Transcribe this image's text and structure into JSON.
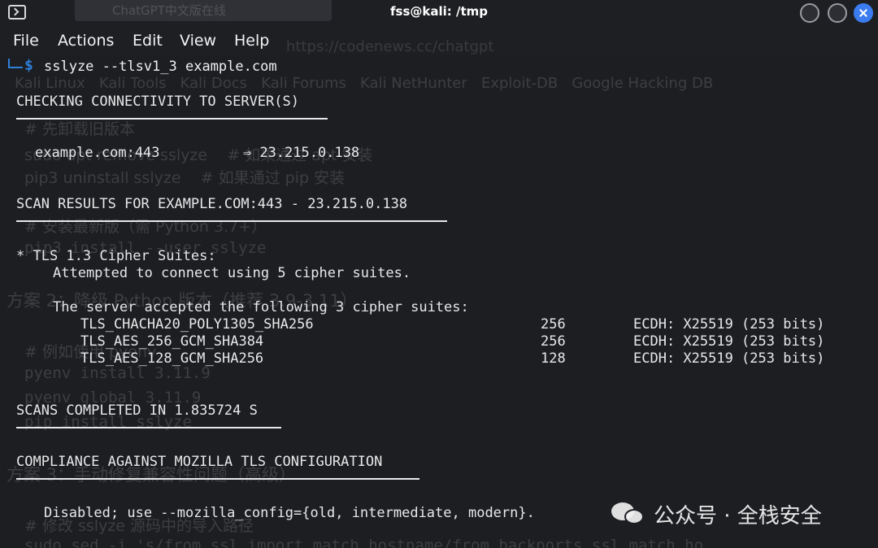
{
  "window": {
    "title": "fss@kali: /tmp",
    "ghost_tab": "ChatGPT中文版在线"
  },
  "menu": [
    "File",
    "Actions",
    "Edit",
    "View",
    "Help"
  ],
  "ghost_url": "https://codenews.cc/chatgpt",
  "prompt": {
    "symbol": "$",
    "command": "sslyze --tlsv1_3 example.com"
  },
  "terminal": {
    "header_connectivity": "CHECKING CONNECTIVITY TO SERVER(S)",
    "connectivity_line": "example.com:443          ⇒ 23.215.0.138",
    "header_scan": "SCAN RESULTS FOR EXAMPLE.COM:443 - 23.215.0.138",
    "tls_title": "* TLS 1.3 Cipher Suites:",
    "attempted": "Attempted to connect using 5 cipher suites.",
    "accepted": "The server accepted the following 3 cipher suites:",
    "ciphers": [
      {
        "name": "TLS_CHACHA20_POLY1305_SHA256",
        "bits": "256",
        "kex": "ECDH: X25519 (253 bits)"
      },
      {
        "name": "TLS_AES_256_GCM_SHA384",
        "bits": "256",
        "kex": "ECDH: X25519 (253 bits)"
      },
      {
        "name": "TLS_AES_128_GCM_SHA256",
        "bits": "128",
        "kex": "ECDH: X25519 (253 bits)"
      }
    ],
    "header_completed": "SCANS COMPLETED IN 1.835724 S",
    "header_compliance": "COMPLIANCE AGAINST MOZILLA TLS CONFIGURATION",
    "disabled_line": "Disabled; use --mozilla_config={old, intermediate, modern}."
  },
  "ghost_bookmarks": "Kali Linux   Kali Tools   Kali Docs   Kali Forums   Kali NetHunter   Exploit-DB   Google Hacking DB",
  "ghost_lines": [
    "# 先卸载旧版本",
    "sudo apt remove sslyze    # 如果通过 apt 安装",
    "pip3 uninstall sslyze    # 如果通过 pip 安装",
    "# 安装最新版（需 Python 3.7+）",
    "pip3 install --user sslyze",
    "方案 2：降级 Python 版本（推荐 3.9-3.11）",
    "# 例如使用 pyenv",
    "pyenv install 3.11.9",
    "pyenv global 3.11.9",
    "pip install sslyze",
    "方案 3：手动修复兼容性问题（高级）",
    "# 修改 sslyze 源码中的导入路径",
    "sudo sed -i 's/from ssl import match_hostname/from backports.ssl_match_ho"
  ],
  "watermark": "公众号 · 全栈安全",
  "colors": {
    "background": "#1c1e22",
    "prompt": "#2f7fd8",
    "close_button": "#3b7cf0",
    "text": "#e8e8e8"
  }
}
